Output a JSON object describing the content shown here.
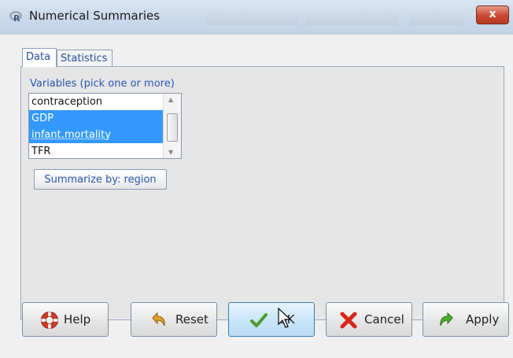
{
  "window": {
    "title": "Numerical Summaries",
    "close_glyph": "x"
  },
  "tabs": [
    {
      "label": "Data",
      "active": true
    },
    {
      "label": "Statistics",
      "active": false
    }
  ],
  "variables": {
    "label": "Variables (pick one or more)",
    "items": [
      {
        "label": "contraception",
        "selected": false
      },
      {
        "label": "GDP",
        "selected": true
      },
      {
        "label": "infant.mortality",
        "selected": true
      },
      {
        "label": "TFR",
        "selected": false
      }
    ]
  },
  "summarize_button": "Summarize by: region",
  "buttons": {
    "help": "Help",
    "reset": "Reset",
    "ok": "OK",
    "cancel": "Cancel",
    "apply": "Apply"
  },
  "colors": {
    "selection": "#3399ff",
    "label_blue": "#2a57b1",
    "close_red": "#c8472f"
  },
  "icons": {
    "title": "r-logo-icon",
    "help": "lifebuoy-icon",
    "reset": "undo-arrow-icon",
    "ok": "checkmark-icon",
    "cancel": "red-x-icon",
    "apply": "redo-arrow-icon"
  }
}
